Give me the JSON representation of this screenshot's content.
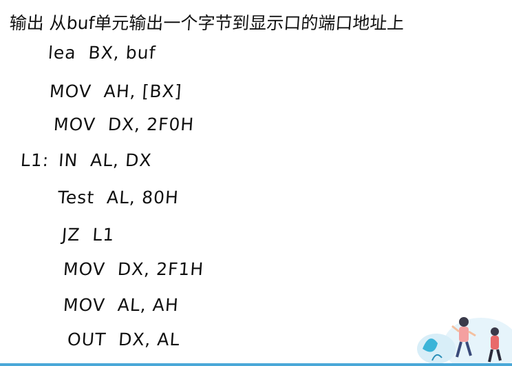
{
  "title": "输出  从buf单元输出一个字节到显示口的端口地址上",
  "code": [
    {
      "label": "",
      "op": "lea",
      "args": "BX, buf"
    },
    {
      "label": "",
      "op": "MOV",
      "args": "AH, [BX]"
    },
    {
      "label": "",
      "op": "MOV",
      "args": "DX, 2F0H"
    },
    {
      "label": "L1:",
      "op": "IN",
      "args": "AL, DX"
    },
    {
      "label": "",
      "op": "Test",
      "args": "AL, 80H"
    },
    {
      "label": "",
      "op": "JZ",
      "args": "L1"
    },
    {
      "label": "",
      "op": "MOV",
      "args": "DX, 2F1H"
    },
    {
      "label": "",
      "op": "MOV",
      "args": "AL, AH"
    },
    {
      "label": "",
      "op": "OUT",
      "args": "DX, AL"
    }
  ],
  "colors": {
    "ink": "#111111",
    "accent": "#4aa8d8"
  }
}
